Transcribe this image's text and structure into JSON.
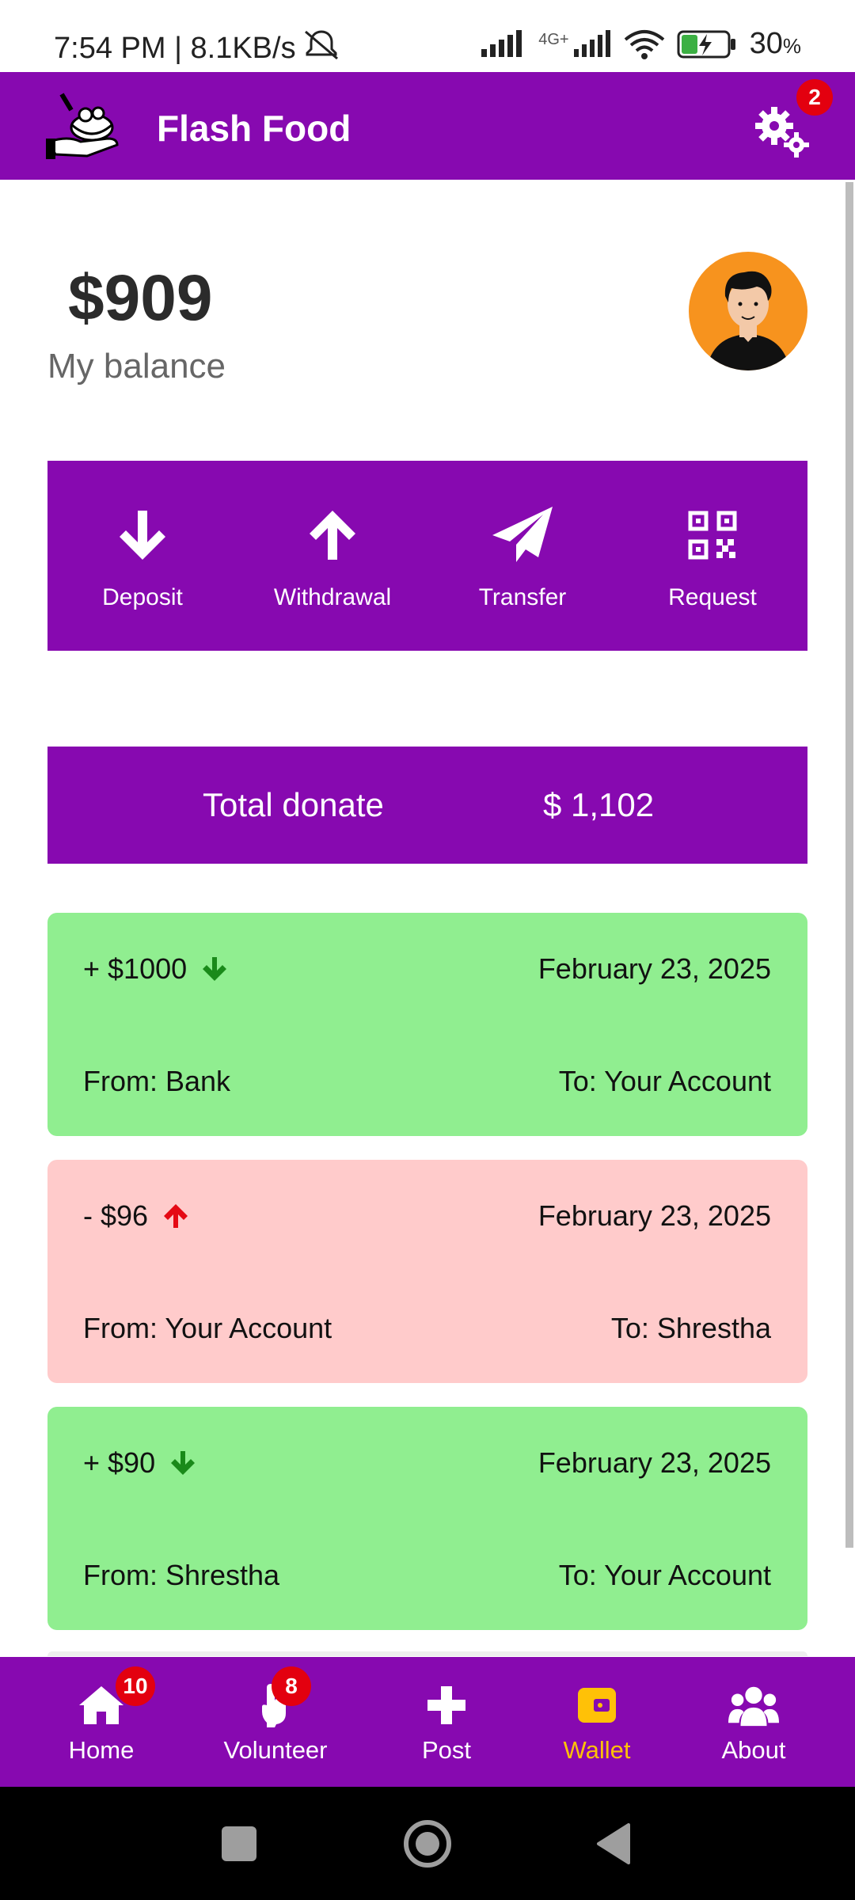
{
  "status_bar": {
    "time_speed": "7:54 PM | 8.1KB/s",
    "network": "4G+",
    "battery_percent": "30",
    "battery_unit": "%"
  },
  "app": {
    "title": "Flash Food",
    "settings_badge": "2"
  },
  "balance": {
    "amount": "$909",
    "label": "My balance"
  },
  "actions": [
    {
      "label": "Deposit",
      "icon": "arrow-down-icon"
    },
    {
      "label": "Withdrawal",
      "icon": "arrow-up-icon"
    },
    {
      "label": "Transfer",
      "icon": "paper-plane-icon"
    },
    {
      "label": "Request",
      "icon": "qr-code-icon"
    }
  ],
  "donate": {
    "label": "Total donate",
    "value": "$ 1,102"
  },
  "transactions": [
    {
      "amount": "+ $1000",
      "direction": "in",
      "date": "February 23, 2025",
      "from": "From: Bank",
      "to": "To: Your Account"
    },
    {
      "amount": "- $96",
      "direction": "out",
      "date": "February 23, 2025",
      "from": "From: Your Account",
      "to": "To: Shrestha"
    },
    {
      "amount": "+ $90",
      "direction": "in",
      "date": "February 23, 2025",
      "from": "From: Shrestha",
      "to": "To: Your Account"
    }
  ],
  "nav": [
    {
      "label": "Home",
      "icon": "home-icon",
      "badge": "10"
    },
    {
      "label": "Volunteer",
      "icon": "volunteer-hand-icon",
      "badge": "8"
    },
    {
      "label": "Post",
      "icon": "plus-icon",
      "badge": ""
    },
    {
      "label": "Wallet",
      "icon": "wallet-icon",
      "badge": "",
      "active": true
    },
    {
      "label": "About",
      "icon": "users-icon",
      "badge": ""
    }
  ],
  "colors": {
    "primary": "#8709b0",
    "credit": "#90ee90",
    "debit": "#ffcbcb",
    "credit_arrow": "#1a8a1a",
    "debit_arrow": "#e50914",
    "active_nav": "#ffc107",
    "badge": "#e3000f"
  }
}
